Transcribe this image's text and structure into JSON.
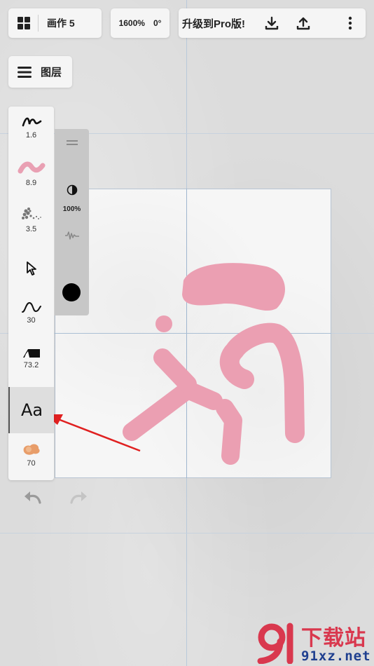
{
  "top_bar": {
    "document_title": "画作 5",
    "zoom_level": "1600%",
    "rotation": "0°",
    "upgrade_label": "升级到Pro版!"
  },
  "layers_button": {
    "label": "图层"
  },
  "toolbar": {
    "tools": [
      {
        "name": "pencil-brush",
        "value": "1.6"
      },
      {
        "name": "marker-brush",
        "value": "8.9",
        "color": "#e9a0b3"
      },
      {
        "name": "spray-brush",
        "value": "3.5"
      },
      {
        "name": "selection-tool",
        "value": ""
      },
      {
        "name": "stroke-smoothing",
        "value": "30"
      },
      {
        "name": "eraser-tool",
        "value": "73.2"
      },
      {
        "name": "text-tool",
        "value": "Aa"
      },
      {
        "name": "blend-tool",
        "value": "70",
        "color": "#e7935a"
      }
    ]
  },
  "brush_panel": {
    "opacity": "100%",
    "current_color": "#000000"
  },
  "canvas": {
    "stroke_color": "#eb9fb2"
  },
  "watermark": {
    "brand_text": "下载站",
    "site_text": "91xz.net"
  },
  "colors": {
    "annotation_arrow": "#e02020"
  }
}
